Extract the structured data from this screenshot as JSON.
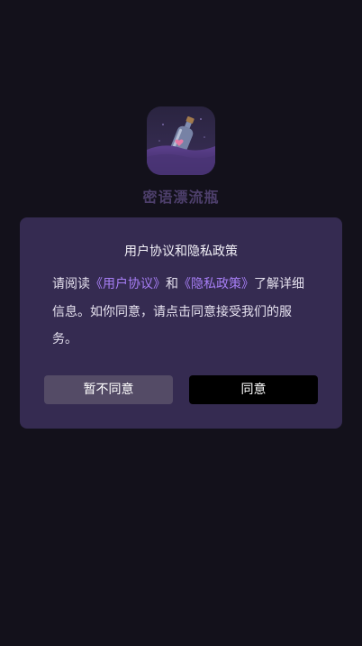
{
  "app": {
    "name": "密语漂流瓶",
    "icon": "message-bottle-icon"
  },
  "dialog": {
    "title": "用户协议和隐私政策",
    "body": {
      "prefix": "请阅读",
      "user_agreement_link": "《用户协议》",
      "conjunction": "和",
      "privacy_policy_link": "《隐私政策》",
      "suffix": "了解详细信息。如你同意，请点击同意接受我们的服务。"
    },
    "decline_label": "暂不同意",
    "agree_label": "同意"
  },
  "colors": {
    "background": "#13111b",
    "dialog": "#352b51",
    "link": "#a77ef5",
    "decline_button": "#544b66",
    "agree_button": "#000000"
  }
}
